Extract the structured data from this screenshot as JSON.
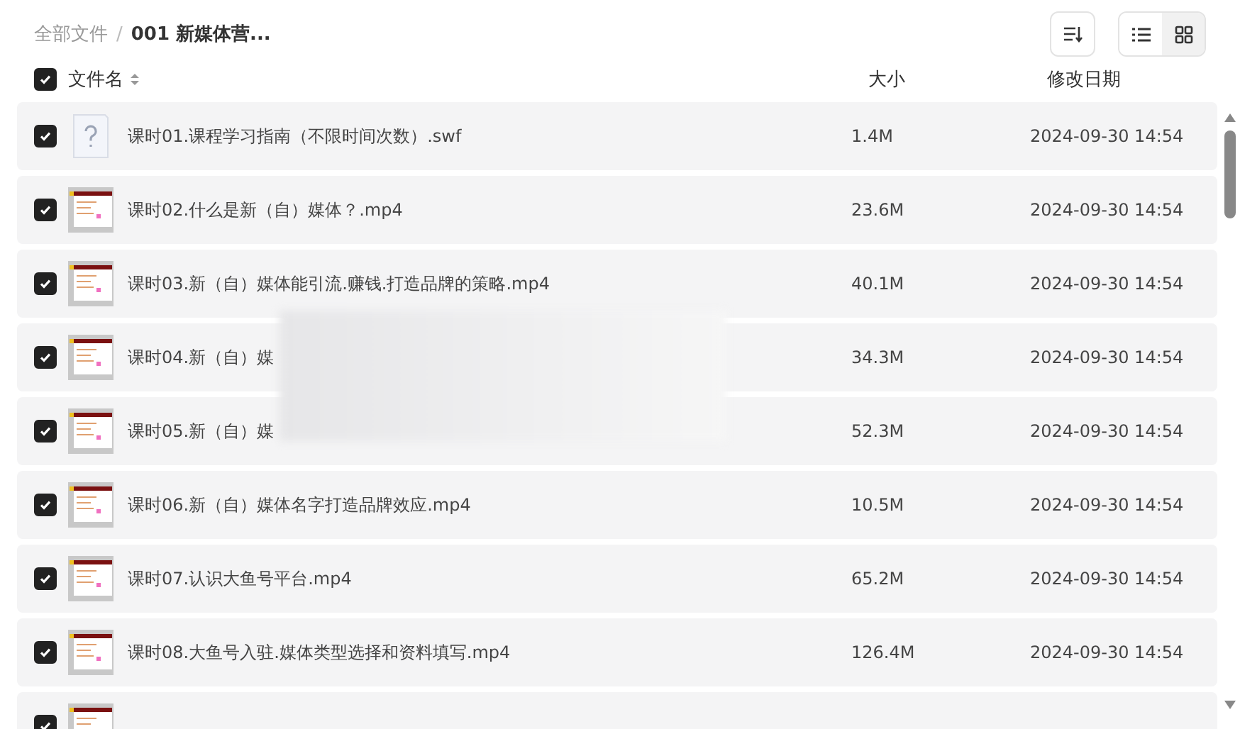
{
  "breadcrumb_separator": "/",
  "breadcrumb": [
    {
      "label": "全部文件",
      "current": false
    },
    {
      "label": "001 新媒体营...",
      "current": true
    }
  ],
  "view_toggle": [
    {
      "kind": "list",
      "selected": false
    },
    {
      "kind": "grid",
      "selected": true
    }
  ],
  "header": {
    "select_all": {
      "checked": true
    },
    "columns": [
      "文件名",
      "大小",
      "修改日期"
    ]
  },
  "files": [
    {
      "name": "课时01.课程学习指南（不限时间次数）.swf",
      "size": "1.4M",
      "modified": "2024-09-30 14:54",
      "checked": true,
      "kind": "unknown"
    },
    {
      "name": "课时02.什么是新（自）媒体？.mp4",
      "size": "23.6M",
      "modified": "2024-09-30 14:54",
      "checked": true,
      "kind": "video"
    },
    {
      "name": "课时03.新（自）媒体能引流.赚钱.打造品牌的策略.mp4",
      "size": "40.1M",
      "modified": "2024-09-30 14:54",
      "checked": true,
      "kind": "video"
    },
    {
      "name": "课时04.新（自）媒",
      "size": "34.3M",
      "modified": "2024-09-30 14:54",
      "checked": true,
      "kind": "video"
    },
    {
      "name": "课时05.新（自）媒",
      "size": "52.3M",
      "modified": "2024-09-30 14:54",
      "checked": true,
      "kind": "video"
    },
    {
      "name": "课时06.新（自）媒体名字打造品牌效应.mp4",
      "size": "10.5M",
      "modified": "2024-09-30 14:54",
      "checked": true,
      "kind": "video"
    },
    {
      "name": "课时07.认识大鱼号平台.mp4",
      "size": "65.2M",
      "modified": "2024-09-30 14:54",
      "checked": true,
      "kind": "video"
    },
    {
      "name": "课时08.大鱼号入驻.媒体类型选择和资料填写.mp4",
      "size": "126.4M",
      "modified": "2024-09-30 14:54",
      "checked": true,
      "kind": "video"
    },
    {
      "checked": true,
      "kind": "video"
    }
  ]
}
